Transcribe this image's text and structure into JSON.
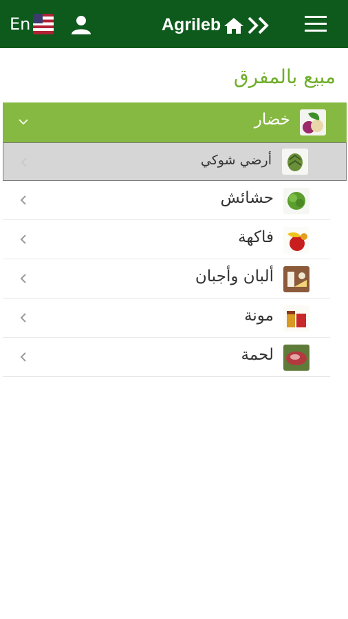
{
  "header": {
    "lang_label": "En",
    "brand": "Agrileb",
    "icons": [
      "us-flag-icon",
      "user-icon",
      "home-icon",
      "double-chevron-icon",
      "hamburger-menu-icon"
    ]
  },
  "page": {
    "title": "مبيع بالمفرق"
  },
  "categories": [
    {
      "label": "خضار",
      "icon": "vegetables-icon",
      "expanded": true,
      "children": [
        {
          "label": "أرضي شوكي",
          "icon": "artichoke-icon"
        }
      ]
    },
    {
      "label": "حشائش",
      "icon": "herbs-icon"
    },
    {
      "label": "فاكهة",
      "icon": "fruit-icon"
    },
    {
      "label": "ألبان وأجبان",
      "icon": "dairy-icon"
    },
    {
      "label": "مونة",
      "icon": "pantry-icon"
    },
    {
      "label": "لحمة",
      "icon": "meat-icon"
    }
  ],
  "colors": {
    "header": "#0d5a1c",
    "accent": "#86b941",
    "title": "#6fae2a"
  }
}
